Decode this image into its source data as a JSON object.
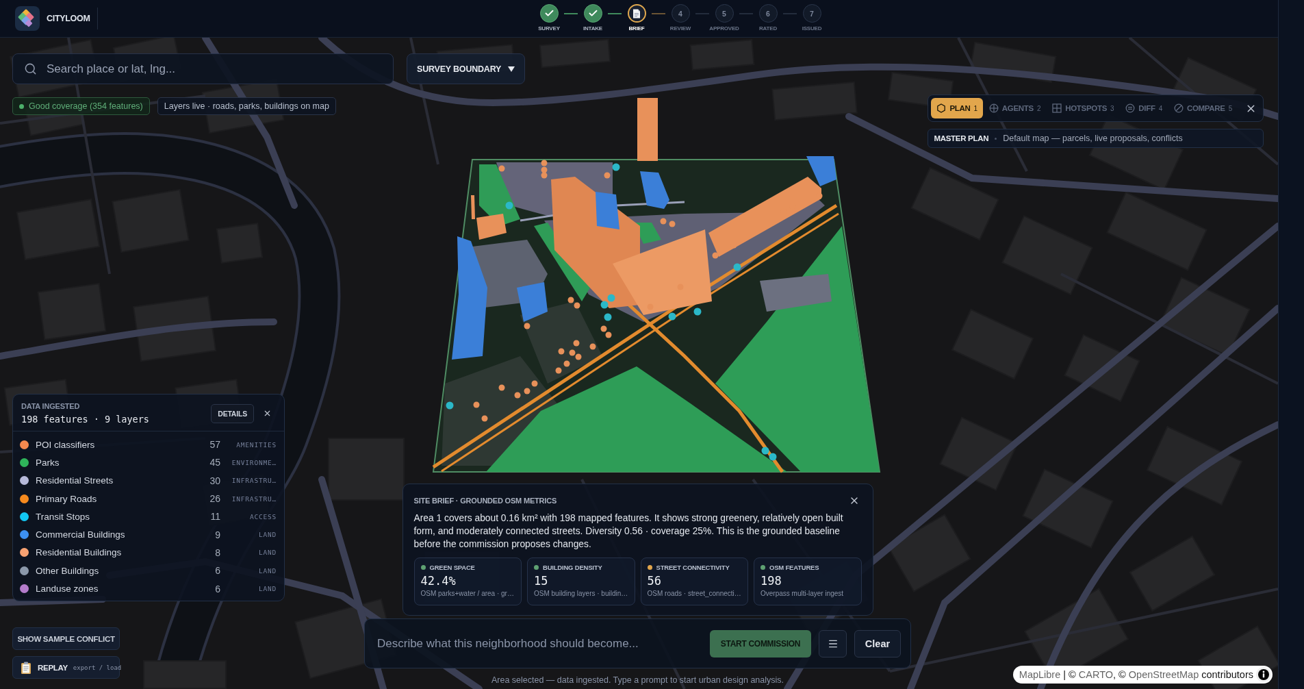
{
  "app": {
    "name": "CITYLOOM"
  },
  "steps": [
    {
      "label": "SURVEY",
      "kind": "done"
    },
    {
      "label": "INTAKE",
      "kind": "done"
    },
    {
      "label": "BRIEF",
      "kind": "current"
    },
    {
      "label": "REVIEW",
      "kind": "pending",
      "number": "4"
    },
    {
      "label": "APPROVED",
      "kind": "pending",
      "number": "5"
    },
    {
      "label": "RATED",
      "kind": "pending",
      "number": "6"
    },
    {
      "label": "ISSUED",
      "kind": "pending",
      "number": "7"
    }
  ],
  "search": {
    "placeholder": "Search place or lat, lng..."
  },
  "boundary_dropdown": {
    "label": "SURVEY BOUNDARY"
  },
  "chips": [
    {
      "kind": "status",
      "text": "Good coverage (354 features)"
    },
    {
      "kind": "info",
      "text": "Layers live · roads, parks, buildings on map"
    }
  ],
  "plan_panel": {
    "tabs": [
      {
        "label": "PLAN",
        "number": "1",
        "selected": true
      },
      {
        "label": "AGENTS",
        "number": "2",
        "selected": false
      },
      {
        "label": "HOTSPOTS",
        "number": "3",
        "selected": false
      },
      {
        "label": "DIFF",
        "number": "4",
        "selected": false
      },
      {
        "label": "COMPARE",
        "number": "5",
        "selected": false
      }
    ],
    "mode": {
      "title": "MASTER PLAN",
      "description": "Default map — parcels, live proposals, conflicts"
    }
  },
  "data_panel": {
    "title": "DATA INGESTED",
    "summary": "198 features · 9 layers",
    "details_button": "DETAILS",
    "layers": [
      {
        "name": "POI classifiers",
        "count": "57",
        "category": "AMENITIES",
        "color": "#f4894f"
      },
      {
        "name": "Parks",
        "count": "45",
        "category": "ENVIRONME…",
        "color": "#2fb45a"
      },
      {
        "name": "Residential Streets",
        "count": "30",
        "category": "INFRASTRU…",
        "color": "#b6b9d9"
      },
      {
        "name": "Primary Roads",
        "count": "26",
        "category": "INFRASTRU…",
        "color": "#f68a1e"
      },
      {
        "name": "Transit Stops",
        "count": "11",
        "category": "ACCESS",
        "color": "#12c6f2"
      },
      {
        "name": "Commercial Buildings",
        "count": "9",
        "category": "LAND",
        "color": "#3d90f2"
      },
      {
        "name": "Residential Buildings",
        "count": "8",
        "category": "LAND",
        "color": "#f8a272"
      },
      {
        "name": "Other Buildings",
        "count": "6",
        "category": "LAND",
        "color": "#8b98aa"
      },
      {
        "name": "Landuse zones",
        "count": "6",
        "category": "LAND",
        "color": "#b47ccb"
      }
    ]
  },
  "sample_conflict_button": "SHOW SAMPLE CONFLICT",
  "replay_button": {
    "label": "REPLAY",
    "hint": "export / load"
  },
  "site_brief": {
    "title": "SITE BRIEF · GROUNDED OSM METRICS",
    "text": "Area 1 covers about 0.16 km² with 198 mapped features. It shows strong greenery, relatively open built form, and moderately connected streets. Diversity 0.56 · coverage 25%. This is the grounded baseline before the commission proposes changes.",
    "metrics": [
      {
        "label": "GREEN SPACE",
        "value": "42.4%",
        "note": "OSM parks+water / area · gr…",
        "color": "#5fa172"
      },
      {
        "label": "BUILDING DENSITY",
        "value": "15",
        "note": "OSM building layers · buildin…",
        "color": "#5fa172"
      },
      {
        "label": "STREET CONNECTIVITY",
        "value": "56",
        "note": "OSM roads · street_connecti…",
        "color": "#e2a64c"
      },
      {
        "label": "OSM FEATURES",
        "value": "198",
        "note": "Overpass multi-layer ingest",
        "color": "#5fa172"
      }
    ]
  },
  "prompt": {
    "placeholder": "Describe what this neighborhood should become...",
    "start_button": {
      "label": "START COMMISSION",
      "disabled": true
    },
    "clear_button": "Clear"
  },
  "status_text": "Area selected — data ingested. Type a prompt to start urban design analysis.",
  "attribution": [
    {
      "text": "MapLibre",
      "link": true
    },
    {
      "text": " | © ",
      "link": false
    },
    {
      "text": "CARTO",
      "link": true
    },
    {
      "text": ", © ",
      "link": false
    },
    {
      "text": "OpenStreetMap",
      "link": true
    },
    {
      "text": " contributors",
      "link": false
    }
  ]
}
